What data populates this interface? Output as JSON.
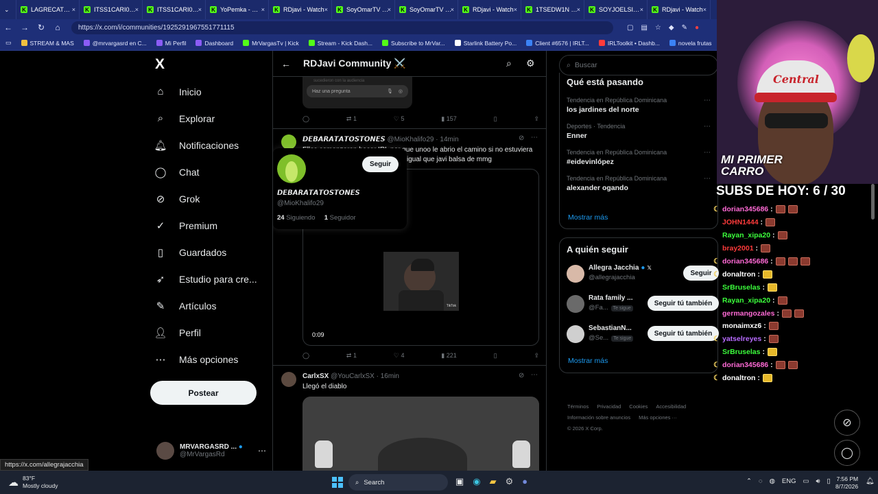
{
  "browser": {
    "tabs": [
      {
        "label": "LAGRECATV - V",
        "icon": "kick"
      },
      {
        "label": "ITSS1CARI0 - W",
        "icon": "kick"
      },
      {
        "label": "ITSS1CARI0 - W",
        "icon": "kick"
      },
      {
        "label": "YoPemka - Watc",
        "icon": "kick"
      },
      {
        "label": "RDjavi - Watch",
        "icon": "kick"
      },
      {
        "label": "SoyOmarTV - W",
        "icon": "kick"
      },
      {
        "label": "SoyOmarTV - W",
        "icon": "kick"
      },
      {
        "label": "RDjavi - Watch",
        "icon": "kick"
      },
      {
        "label": "1TSEDW1N - W",
        "icon": "kick"
      },
      {
        "label": "SOYJOELSITO -",
        "icon": "kick"
      },
      {
        "label": "RDjavi - Watch",
        "icon": "kick"
      }
    ],
    "url": "https://x.com/i/communities/1925291967551771115",
    "bookmarks": [
      "STREAM & MAS",
      "@mrvargasrd en C...",
      "Mi Perfil",
      "Dashboard",
      "MrVargasTv | Kick",
      "Stream - Kick Dash...",
      "Subscribe to MrVar...",
      "Starlink Battery Po...",
      "Client #6576 | IRLT...",
      "IRLToolkit • Dashb...",
      "novela frutas",
      "Cu"
    ],
    "status_url": "https://x.com/allegrajacchia"
  },
  "nav": {
    "logo": "X",
    "items": [
      {
        "label": "Inicio",
        "icon": "⌂",
        "icon_name": "home-icon"
      },
      {
        "label": "Explorar",
        "icon": "⌕",
        "icon_name": "search-icon"
      },
      {
        "label": "Notificaciones",
        "icon": "🔔︎",
        "icon_name": "bell-icon"
      },
      {
        "label": "Chat",
        "icon": "◯",
        "icon_name": "chat-icon"
      },
      {
        "label": "Grok",
        "icon": "⊘",
        "icon_name": "grok-icon"
      },
      {
        "label": "Premium",
        "icon": "✓",
        "icon_name": "premium-icon"
      },
      {
        "label": "Guardados",
        "icon": "▯",
        "icon_name": "bookmark-icon"
      },
      {
        "label": "Estudio para cre...",
        "icon": "➶",
        "icon_name": "studio-icon"
      },
      {
        "label": "Artículos",
        "icon": "✎",
        "icon_name": "articles-icon"
      },
      {
        "label": "Perfil",
        "icon": "👤︎",
        "icon_name": "profile-icon"
      },
      {
        "label": "Más opciones",
        "icon": "⋯",
        "icon_name": "more-icon"
      }
    ],
    "post_button": "Postear",
    "account": {
      "name": "MRVARGASRD ...",
      "handle": "@MrVargasRd"
    }
  },
  "community": {
    "title": "RDJavi Community ⚔️",
    "top_post": {
      "input_placeholder": "Haz una pregunta",
      "faint_text": "sucedieron con la audiencia",
      "replies": "",
      "reposts": "1",
      "likes": "5",
      "views": "157"
    },
    "post1": {
      "author": "𝘿𝙀𝘽𝘼𝙍𝘼𝙏𝘼𝙏𝙊𝙎𝙏𝙊𝙉𝙀𝙎",
      "handle": "@MioKhalifo29",
      "time": "· 14min",
      "text_line1": "Ellos comenzaron hacer IRL por que unoo le abrio el camino si no estuviera",
      "text_line2": "igual que javi balsa de mmg",
      "video_time": "0:09",
      "video_watermark": "TikTok",
      "reposts": "1",
      "likes": "4",
      "views": "221"
    },
    "hovercard": {
      "name": "𝘿𝙀𝘽𝘼𝙍𝘼𝙏𝘼𝙏𝙊𝙎𝙏𝙊𝙉𝙀𝙎",
      "handle": "@MioKhalifo29",
      "follow": "Seguir",
      "following_count": "24",
      "following_label": "Siguiendo",
      "followers_count": "1",
      "followers_label": "Seguidor"
    },
    "post2": {
      "author": "CarlxSX",
      "handle": "@YouCarlxSX",
      "time": "· 16min",
      "text": "Llegó el diablo"
    }
  },
  "sidebar": {
    "search_placeholder": "Buscar",
    "trends_title": "Qué está pasando",
    "trends": [
      {
        "category": "Tendencia en República Dominicana",
        "name": "los jardines del norte"
      },
      {
        "category": "Deportes · Tendencia",
        "name": "Enner"
      },
      {
        "category": "Tendencia en República Dominicana",
        "name": "#eidevinlópez"
      },
      {
        "category": "Tendencia en República Dominicana",
        "name": "alexander ogando"
      }
    ],
    "show_more": "Mostrar más",
    "who_to_follow_title": "A quién seguir",
    "suggestions": [
      {
        "name": "Allegra Jacchia",
        "handle": "@allegrajacchia",
        "button": "Seguir",
        "badge": ""
      },
      {
        "name": "Rata family ...",
        "handle": "@Fa...",
        "button": "Seguir tú también",
        "badge": "Te sigue"
      },
      {
        "name": "SebastianN...",
        "handle": "@Se...",
        "button": "Seguir tú también",
        "badge": "Te sigue"
      }
    ],
    "show_more_2": "Mostrar más",
    "footer_line1": [
      "Términos",
      "Privacidad",
      "Cookies",
      "Accesibilidad"
    ],
    "footer_line2": [
      "Información sobre anuncios",
      "Más opciones ···"
    ],
    "copyright": "© 2026 X Corp."
  },
  "stream_overlay": {
    "cap_text": "Central",
    "banner": "MI PRIMER CARRO",
    "subs_label": "SUBS DE HOY: 6 / 30",
    "chat": [
      {
        "user": "dorian345686",
        "color": "#ff6ad5",
        "emotes": 2,
        "prefix": "☾"
      },
      {
        "user": "JOHN1444",
        "color": "#ff3b3b",
        "emotes": 1,
        "prefix": ""
      },
      {
        "user": "Rayan_xipa20",
        "color": "#3cff3c",
        "emotes": 1,
        "prefix": ""
      },
      {
        "user": "bray2001",
        "color": "#ff3b3b",
        "emotes": 1,
        "prefix": ""
      },
      {
        "user": "dorian345686",
        "color": "#ff6ad5",
        "emotes": 3,
        "prefix": "☾"
      },
      {
        "user": "donaltron",
        "color": "#ffffff",
        "emotes": 1,
        "prefix": "☾"
      },
      {
        "user": "SrBruselas",
        "color": "#3cff3c",
        "emotes": 1,
        "prefix": ""
      },
      {
        "user": "Rayan_xipa20",
        "color": "#3cff3c",
        "emotes": 1,
        "prefix": ""
      },
      {
        "user": "germangozales",
        "color": "#ff6ad5",
        "emotes": 2,
        "prefix": ""
      },
      {
        "user": "monaimxz6",
        "color": "#ffffff",
        "emotes": 1,
        "prefix": ""
      },
      {
        "user": "yatselreyes",
        "color": "#b86bff",
        "emotes": 1,
        "prefix": "☾"
      },
      {
        "user": "SrBruselas",
        "color": "#3cff3c",
        "emotes": 1,
        "prefix": ""
      },
      {
        "user": "dorian345686",
        "color": "#ff6ad5",
        "emotes": 2,
        "prefix": "☾"
      },
      {
        "user": "donaltron",
        "color": "#ffffff",
        "emotes": 1,
        "prefix": "☾"
      }
    ]
  },
  "taskbar": {
    "weather_temp": "83°F",
    "weather_desc": "Mostly cloudy",
    "search": "Search",
    "lang": "ENG",
    "time": "7:56 PM",
    "date": "8/7/2026"
  }
}
